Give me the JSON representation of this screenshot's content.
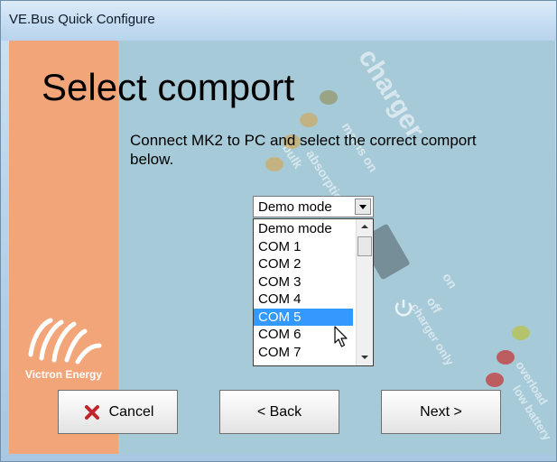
{
  "window": {
    "title": "VE.Bus Quick Configure"
  },
  "page": {
    "heading": "Select comport",
    "instructions": "Connect MK2 to PC and select the correct comport below."
  },
  "comport": {
    "selected_value": "Demo mode",
    "options": [
      "Demo mode",
      "COM 1",
      "COM 2",
      "COM 3",
      "COM 4",
      "COM 5",
      "COM 6",
      "COM 7"
    ],
    "highlighted_option": "COM 5"
  },
  "buttons": {
    "cancel": "Cancel",
    "back": "< Back",
    "next": "Next >"
  },
  "brand": {
    "name": "Victron Energy"
  },
  "background_panel": {
    "labels": [
      "charger",
      "mains on",
      "bulk",
      "absorption",
      "on",
      "off",
      "charger only",
      "overload",
      "low battery"
    ]
  },
  "colors": {
    "accent_orange": "#f3a57a",
    "panel_blue": "#a7cad8",
    "selection": "#3399ff",
    "cancel_icon": "#c0262b"
  }
}
